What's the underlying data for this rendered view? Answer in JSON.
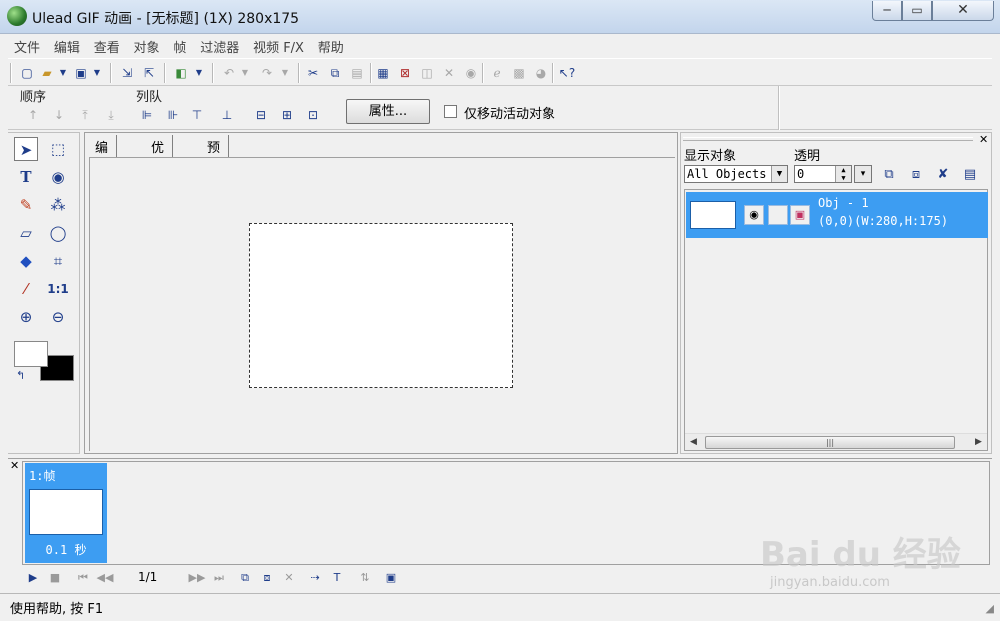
{
  "window": {
    "title": "Ulead GIF 动画 - [无标题] (1X) 280x175",
    "min_label": "─",
    "max_label": "▭",
    "close_label": "✕"
  },
  "menu": [
    "文件",
    "编辑",
    "查看",
    "对象",
    "帧",
    "过滤器",
    "视频 F/X",
    "帮助"
  ],
  "attr": {
    "order_label": "顺序",
    "queue_label": "列队",
    "properties_button": "属性...",
    "move_active_label": "仅移动活动对象"
  },
  "editor": {
    "tabs": [
      "编辑",
      "优化",
      "预览"
    ]
  },
  "objects": {
    "show_label": "显示对象",
    "opacity_label": "透明",
    "show_value": "All Objects",
    "opacity_value": "0",
    "rows": [
      {
        "name": "Obj - 1",
        "info": "(0,0)(W:280,H:175)"
      }
    ]
  },
  "frames": {
    "items": [
      {
        "label": "1:帧",
        "delay": "0.1 秒"
      }
    ],
    "counter": "1/1"
  },
  "status": {
    "text": "使用帮助, 按 F1"
  },
  "watermark": {
    "text": "Bai  du 经验",
    "sub": "jingyan.baidu.com"
  },
  "colors": {
    "selection": "#3d9df2",
    "foreground": "#ffffff",
    "background": "#000000"
  }
}
